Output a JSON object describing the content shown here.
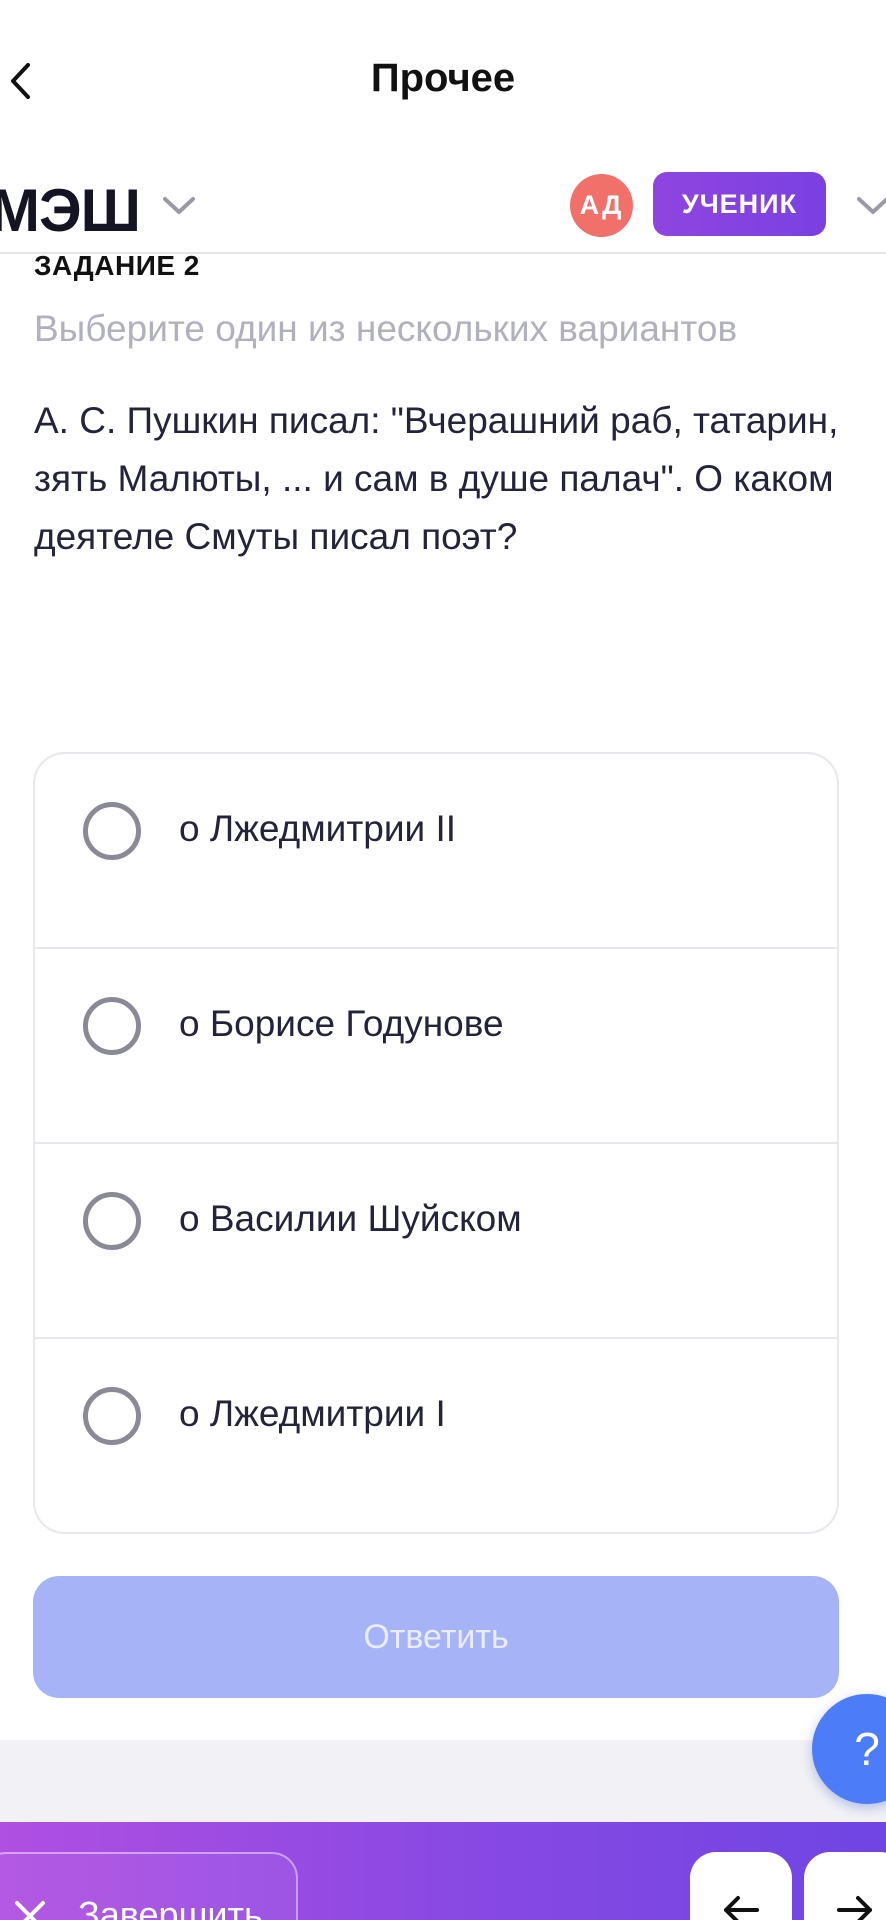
{
  "nav": {
    "title": "Прочее",
    "back_icon": "chevron-left-icon"
  },
  "header": {
    "logo": "МЭШ",
    "avatar_initials": "АД",
    "role": "УЧЕНИК",
    "colors": {
      "avatar": "#f1706a",
      "role_badge": "#8f45e0"
    }
  },
  "task": {
    "label": "ЗАДАНИЕ 2",
    "instruction": "Выберите один из нескольких вариантов",
    "question": "А. С. Пушкин писал: \"Вчерашний раб, татарин, зять Малюты, ... и сам в душе палач\". О каком деятеле Смуты писал поэт?",
    "options": [
      {
        "label": "о Лжедмитрии II",
        "selected": false
      },
      {
        "label": "о Борисе Годунове",
        "selected": false
      },
      {
        "label": "о Василии Шуйском",
        "selected": false
      },
      {
        "label": "о Лжедмитрии I",
        "selected": false
      }
    ],
    "answer_label": "Ответить",
    "answer_enabled": false
  },
  "help": {
    "label": "?",
    "color": "#4c7cf7"
  },
  "bottom": {
    "finish_label": "Завершить",
    "finish_icon": "close-icon",
    "prev_icon": "arrow-left-icon",
    "next_icon": "arrow-right-icon",
    "gradient": [
      "#b04fe2",
      "#6f45e3"
    ]
  }
}
